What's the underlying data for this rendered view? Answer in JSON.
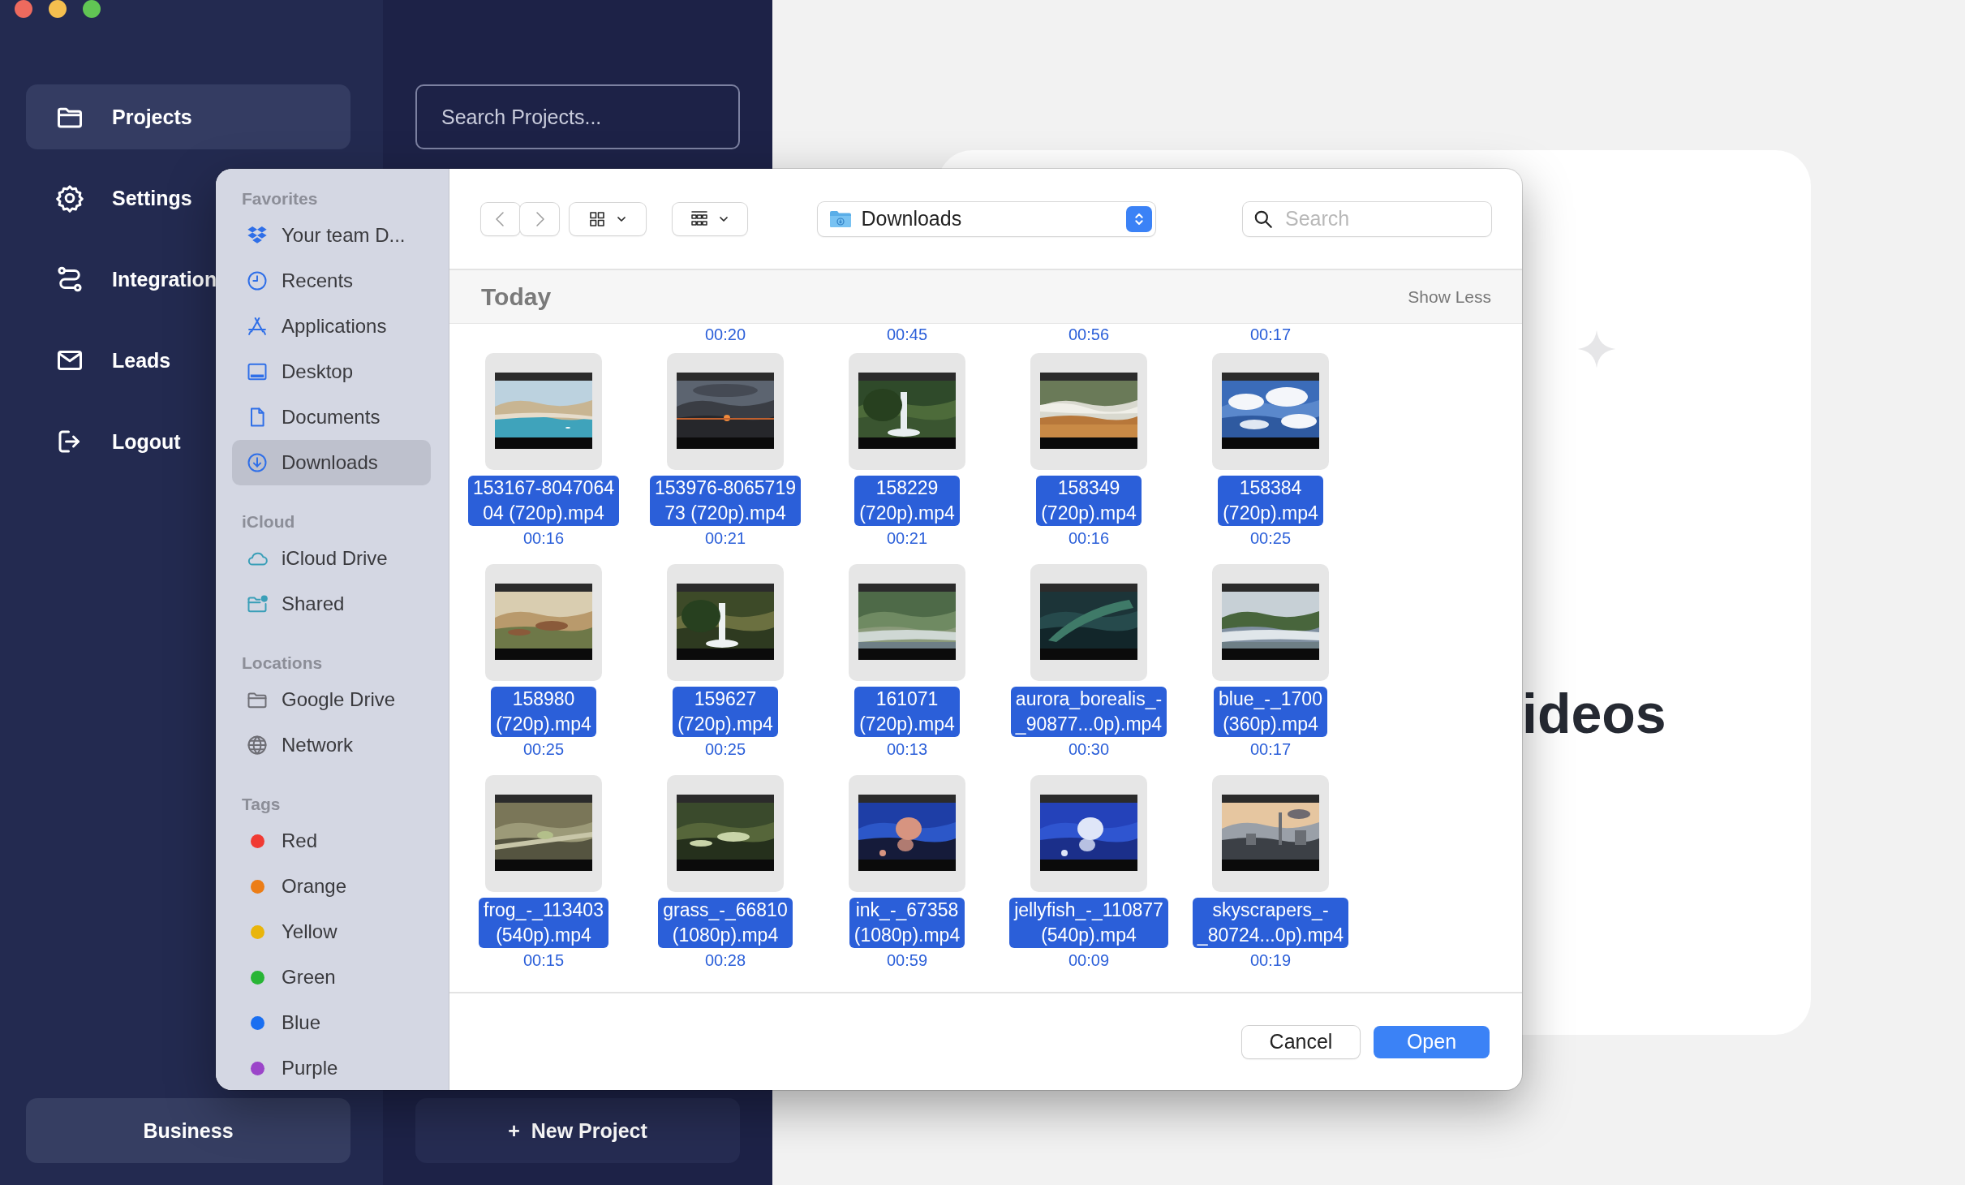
{
  "app": {
    "nav": [
      {
        "label": "Projects",
        "selected": true
      },
      {
        "label": "Settings",
        "selected": false
      },
      {
        "label": "Integration",
        "selected": false
      },
      {
        "label": "Leads",
        "selected": false
      },
      {
        "label": "Logout",
        "selected": false
      }
    ],
    "search": {
      "placeholder": "Search Projects..."
    },
    "plan_button": "Business",
    "new_project_button": {
      "icon": "+",
      "label": "New Project"
    },
    "card": {
      "heading": "ideos"
    }
  },
  "dialog": {
    "sidebar": [
      {
        "title": "Favorites",
        "kind": "places",
        "items": [
          {
            "label": "Your team D...",
            "selected": false
          },
          {
            "label": "Recents",
            "selected": false
          },
          {
            "label": "Applications",
            "selected": false
          },
          {
            "label": "Desktop",
            "selected": false
          },
          {
            "label": "Documents",
            "selected": false
          },
          {
            "label": "Downloads",
            "selected": true
          }
        ]
      },
      {
        "title": "iCloud",
        "kind": "places",
        "items": [
          {
            "label": "iCloud Drive",
            "selected": false
          },
          {
            "label": "Shared",
            "selected": false
          }
        ]
      },
      {
        "title": "Locations",
        "kind": "places",
        "items": [
          {
            "label": "Google Drive",
            "selected": false
          },
          {
            "label": "Network",
            "selected": false
          }
        ]
      },
      {
        "title": "Tags",
        "kind": "tags",
        "items": [
          {
            "label": "Red",
            "color": "#f03a33",
            "selected": false
          },
          {
            "label": "Orange",
            "color": "#ec7d16",
            "selected": false
          },
          {
            "label": "Yellow",
            "color": "#e9b50b",
            "selected": false
          },
          {
            "label": "Green",
            "color": "#28b535",
            "selected": false
          },
          {
            "label": "Blue",
            "color": "#1a6ff1",
            "selected": false
          },
          {
            "label": "Purple",
            "color": "#9b45c9",
            "selected": false
          }
        ]
      }
    ],
    "location": "Downloads",
    "search": {
      "placeholder": "Search"
    },
    "section": {
      "title": "Today",
      "toggle": "Show Less"
    },
    "previous_row_durations": [
      "00:20",
      "00:45",
      "00:56",
      "00:17"
    ],
    "files": [
      {
        "name_lines": [
          "153167-8047064",
          "04 (720p).mp4"
        ],
        "duration": "00:16",
        "selected": true
      },
      {
        "name_lines": [
          "153976-8065719",
          "73 (720p).mp4"
        ],
        "duration": "00:21",
        "selected": true
      },
      {
        "name_lines": [
          "158229",
          "(720p).mp4"
        ],
        "duration": "00:21",
        "selected": true
      },
      {
        "name_lines": [
          "158349",
          "(720p).mp4"
        ],
        "duration": "00:16",
        "selected": true
      },
      {
        "name_lines": [
          "158384",
          "(720p).mp4"
        ],
        "duration": "00:25",
        "selected": true
      },
      {
        "name_lines": [
          "158980",
          "(720p).mp4"
        ],
        "duration": "00:25",
        "selected": true
      },
      {
        "name_lines": [
          "159627",
          "(720p).mp4"
        ],
        "duration": "00:25",
        "selected": true
      },
      {
        "name_lines": [
          "161071",
          "(720p).mp4"
        ],
        "duration": "00:13",
        "selected": true
      },
      {
        "name_lines": [
          "aurora_borealis_-",
          "_90877...0p).mp4"
        ],
        "duration": "00:30",
        "selected": true
      },
      {
        "name_lines": [
          "blue_-_1700",
          "(360p).mp4"
        ],
        "duration": "00:17",
        "selected": true
      },
      {
        "name_lines": [
          "frog_-_113403",
          "(540p).mp4"
        ],
        "duration": "00:15",
        "selected": true
      },
      {
        "name_lines": [
          "grass_-_66810",
          "(1080p).mp4"
        ],
        "duration": "00:28",
        "selected": true
      },
      {
        "name_lines": [
          "ink_-_67358",
          "(1080p).mp4"
        ],
        "duration": "00:59",
        "selected": true
      },
      {
        "name_lines": [
          "jellyfish_-_110877",
          "(540p).mp4"
        ],
        "duration": "00:09",
        "selected": true
      },
      {
        "name_lines": [
          "skyscrapers_-",
          "_80724...0p).mp4"
        ],
        "duration": "00:19",
        "selected": true
      }
    ],
    "buttons": {
      "cancel": "Cancel",
      "open": "Open"
    }
  }
}
